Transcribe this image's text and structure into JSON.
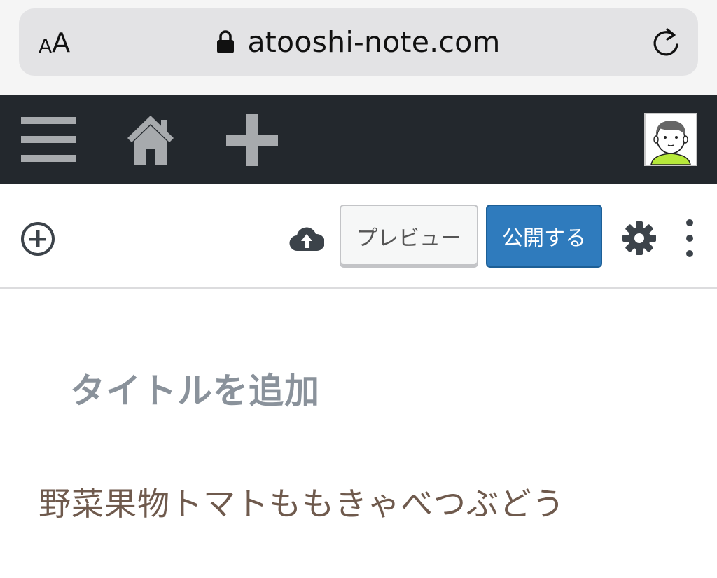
{
  "browser": {
    "text_size_small": "A",
    "text_size_large": "A",
    "url": "atooshi-note.com",
    "icons": {
      "lock": "lock-icon",
      "reload": "reload-icon"
    }
  },
  "admin_bar": {
    "icons": [
      "menu-icon",
      "home-icon",
      "plus-icon",
      "avatar"
    ]
  },
  "editor_toolbar": {
    "preview_label": "プレビュー",
    "publish_label": "公開する",
    "icons": [
      "add-block-icon",
      "cloud-upload-icon",
      "gear-icon",
      "more-vertical-icon"
    ],
    "publish_color": "#2f7bbd"
  },
  "editor": {
    "title_placeholder": "タイトルを追加",
    "paragraph_text": "野菜果物トマトももきゃべつぶどう"
  }
}
